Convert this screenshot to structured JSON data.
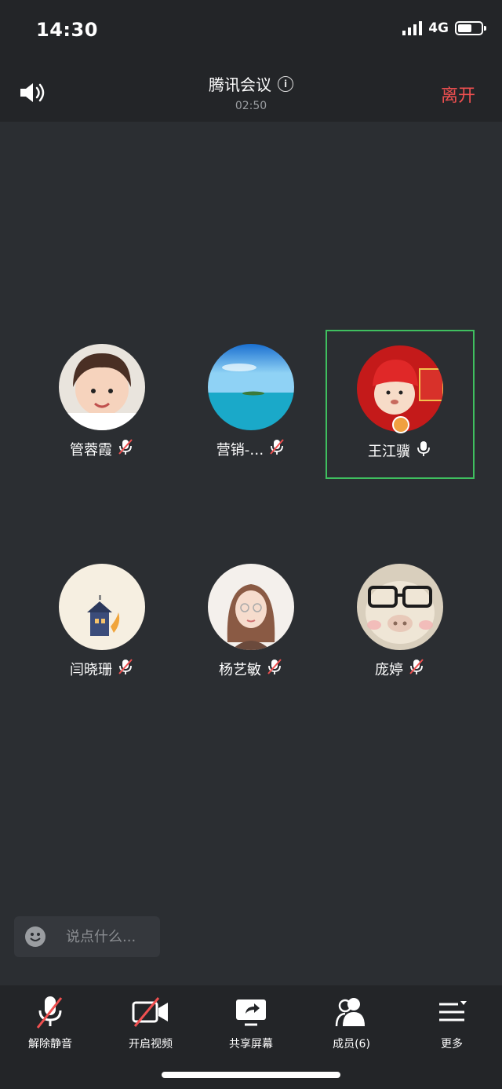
{
  "status": {
    "time": "14:30",
    "network": "4G",
    "battery_fraction": 0.6
  },
  "header": {
    "title": "腾讯会议",
    "duration": "02:50",
    "leave_label": "离开"
  },
  "participants": [
    {
      "name": "管蓉霞",
      "mic": "muted"
    },
    {
      "name": "营销-…",
      "mic": "muted"
    },
    {
      "name": "王江骥",
      "mic": "on",
      "active": true
    },
    {
      "name": "闫晓珊",
      "mic": "muted"
    },
    {
      "name": "杨艺敏",
      "mic": "muted"
    },
    {
      "name": "庞婷",
      "mic": "muted"
    }
  ],
  "chat": {
    "placeholder": "说点什么..."
  },
  "toolbar": {
    "unmute": "解除静音",
    "video": "开启视频",
    "share": "共享屏幕",
    "members": "成员(6)",
    "more": "更多"
  },
  "colors": {
    "active_border": "#3fbf5f",
    "leave": "#f05050",
    "background": "#2b2e32"
  }
}
